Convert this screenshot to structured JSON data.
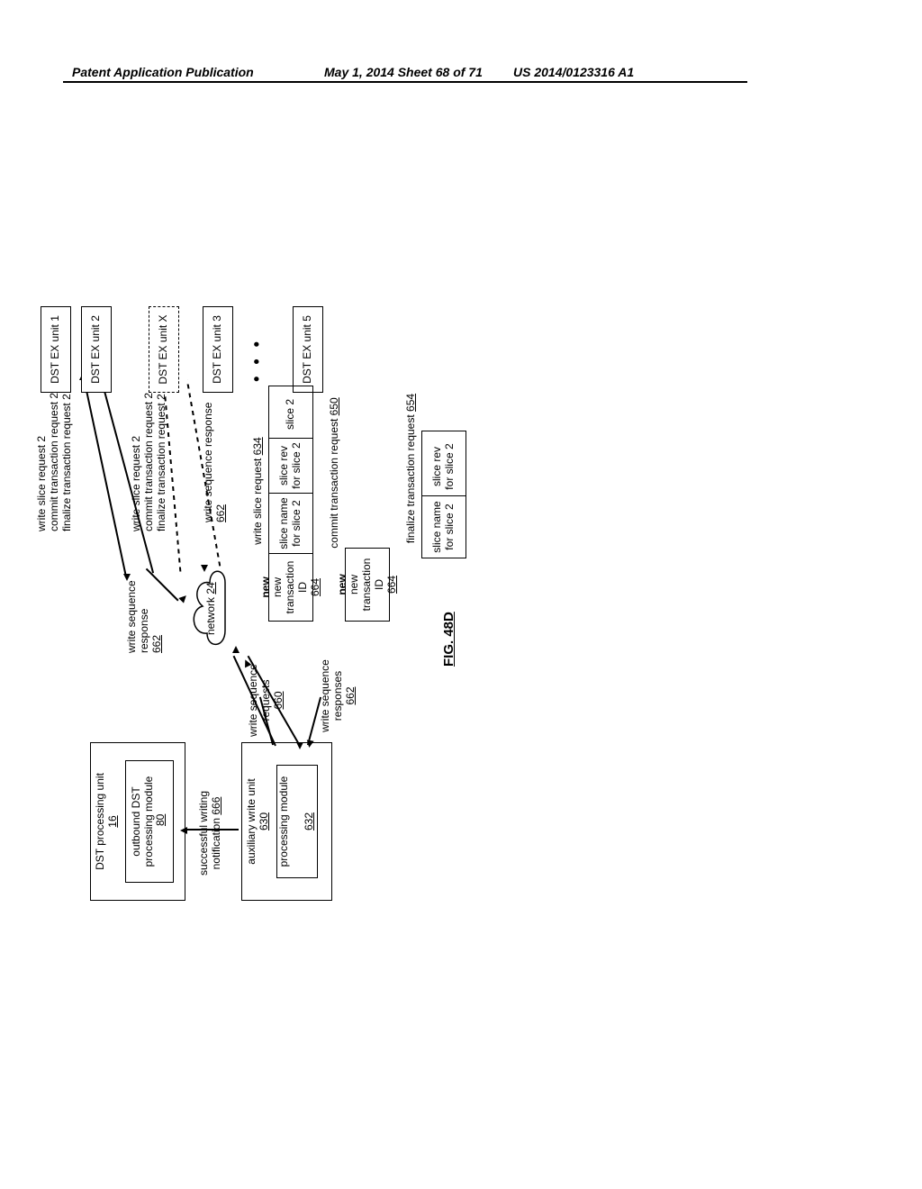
{
  "header": {
    "left": "Patent Application Publication",
    "mid": "May 1, 2014  Sheet 68 of 71",
    "right": "US 2014/0123316 A1"
  },
  "fig": "FIG. 48D",
  "units": {
    "dst_processing": "DST processing unit",
    "dst_processing_num": "16",
    "outbound": "outbound DST processing module",
    "outbound_num": "80",
    "aux": "auxiliary write unit",
    "aux_num": "630",
    "proc_mod": "processing module",
    "proc_mod_num": "632",
    "ex1": "DST EX unit 1",
    "ex2": "DST EX unit 2",
    "exX": "DST EX unit X",
    "ex3": "DST EX unit 3",
    "ex5": "DST EX unit 5"
  },
  "labels": {
    "succ": "successful writing notification",
    "succ_num": "666",
    "wsr": "write sequence requests",
    "wsr_num": "660",
    "wresp": "write sequence responses",
    "wresp_num": "662",
    "net": "network",
    "net_num": "24",
    "wseq_resp1": "write sequence response",
    "wseq_resp1_num": "662",
    "wseq_resp2": "write sequence response",
    "wseq_resp2_num": "662",
    "to_unit2_a": "write slice request 2",
    "to_unit2_b": "commit transaction request 2",
    "to_unit2_c": "finalize transaction request 2",
    "to_unitX_a": "write slice request 2",
    "to_unitX_b": "commit transaction request 2",
    "to_unitX_c": "finalize transaction request 2",
    "dots": "• • •"
  },
  "tables": {
    "wsr_title": "write slice request",
    "wsr_title_num": "634",
    "new_txn_id": "new transaction ID",
    "new_txn_num": "664",
    "slice_name2": "slice name for slice 2",
    "slice_rev2": "slice rev for slice 2",
    "slice2": "slice 2",
    "ctr_title": "commit transaction request",
    "ctr_title_num": "650",
    "ftr_title": "finalize transaction request",
    "ftr_title_num": "654"
  }
}
